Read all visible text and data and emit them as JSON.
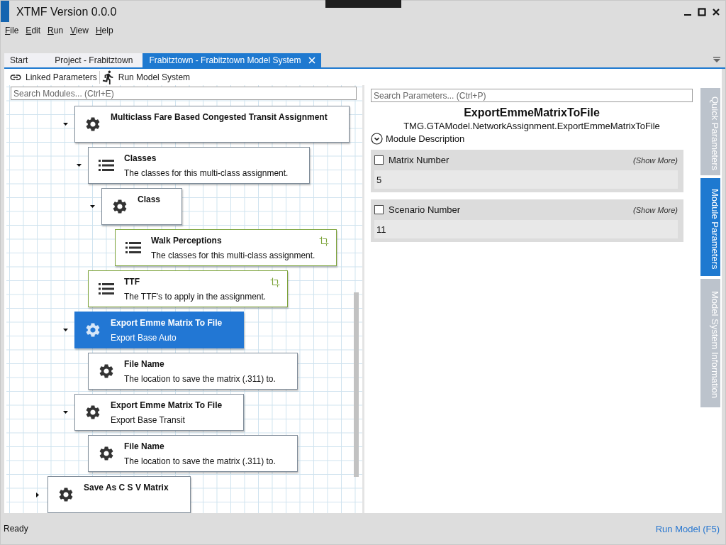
{
  "window": {
    "title": "XTMF Version 0.0.0"
  },
  "menu": [
    "File",
    "Edit",
    "Run",
    "View",
    "Help"
  ],
  "tabs": [
    {
      "label": "Start",
      "selected": false,
      "closable": false
    },
    {
      "label": "Project - Frabitztown",
      "selected": false,
      "closable": false
    },
    {
      "label": "Frabitztown - Frabitztown Model System",
      "selected": true,
      "closable": true
    }
  ],
  "toolbar": [
    "Linked Parameters",
    "Run Model System"
  ],
  "module_search": {
    "placeholder": "Search Modules... (Ctrl+E)"
  },
  "tree": {
    "scrolled_branch": [
      {
        "kind": "module",
        "title": "Multiclass Fare Based Congested Transit Assignment",
        "selected": false,
        "linked": false,
        "expanded": true,
        "children": [
          {
            "kind": "collection",
            "title": "Classes",
            "description": "The classes for this multi-class assignment.",
            "selected": false,
            "linked": false,
            "expanded": true,
            "children": [
              {
                "kind": "module",
                "title": "Class",
                "selected": false,
                "linked": false,
                "expanded": true,
                "children": [
                  {
                    "kind": "collection",
                    "title": "Walk Perceptions",
                    "description": "The classes for this multi-class assignment.",
                    "selected": false,
                    "linked": true
                  }
                ]
              }
            ]
          },
          {
            "kind": "collection",
            "title": "TTF",
            "description": "The TTF's to apply in the assignment.",
            "selected": false,
            "linked": true
          }
        ]
      },
      {
        "kind": "module",
        "title": "Export Emme Matrix To File",
        "description": "Export Base Auto",
        "selected": true,
        "linked": false,
        "expanded": true,
        "children": [
          {
            "kind": "module",
            "title": "File Name",
            "description": "The location to save the matrix (.311) to.",
            "selected": false,
            "linked": false
          }
        ]
      },
      {
        "kind": "module",
        "title": "Export Emme Matrix To File",
        "description": "Export Base Transit",
        "selected": false,
        "linked": false,
        "expanded": true,
        "children": [
          {
            "kind": "module",
            "title": "File Name",
            "description": "The location to save the matrix (.311) to.",
            "selected": false,
            "linked": false
          }
        ]
      }
    ],
    "items": [
      {
        "kind": "module",
        "title": "Save As C S V Matrix",
        "selected": false,
        "linked": false,
        "expanded": false
      }
    ]
  },
  "parameter_search": {
    "placeholder": "Search Parameters... (Ctrl+P)"
  },
  "module": {
    "name": "ExportEmmeMatrixToFile",
    "type": "TMG.GTAModel.NetworkAssignment.ExportEmmeMatrixToFile",
    "description_toggle": "Module Description"
  },
  "parameters": [
    {
      "name": "Matrix Number",
      "checked": false,
      "show_more": "(Show More)",
      "value": "5"
    },
    {
      "name": "Scenario Number",
      "checked": false,
      "show_more": "(Show More)",
      "value": "11"
    }
  ],
  "side_tabs": [
    {
      "label": "Quick Parameters",
      "selected": false
    },
    {
      "label": "Module Parameters",
      "selected": true
    },
    {
      "label": "Model System Information",
      "selected": false
    }
  ],
  "status_bar": {
    "status": "Ready",
    "action": "Run Model (F5)"
  }
}
